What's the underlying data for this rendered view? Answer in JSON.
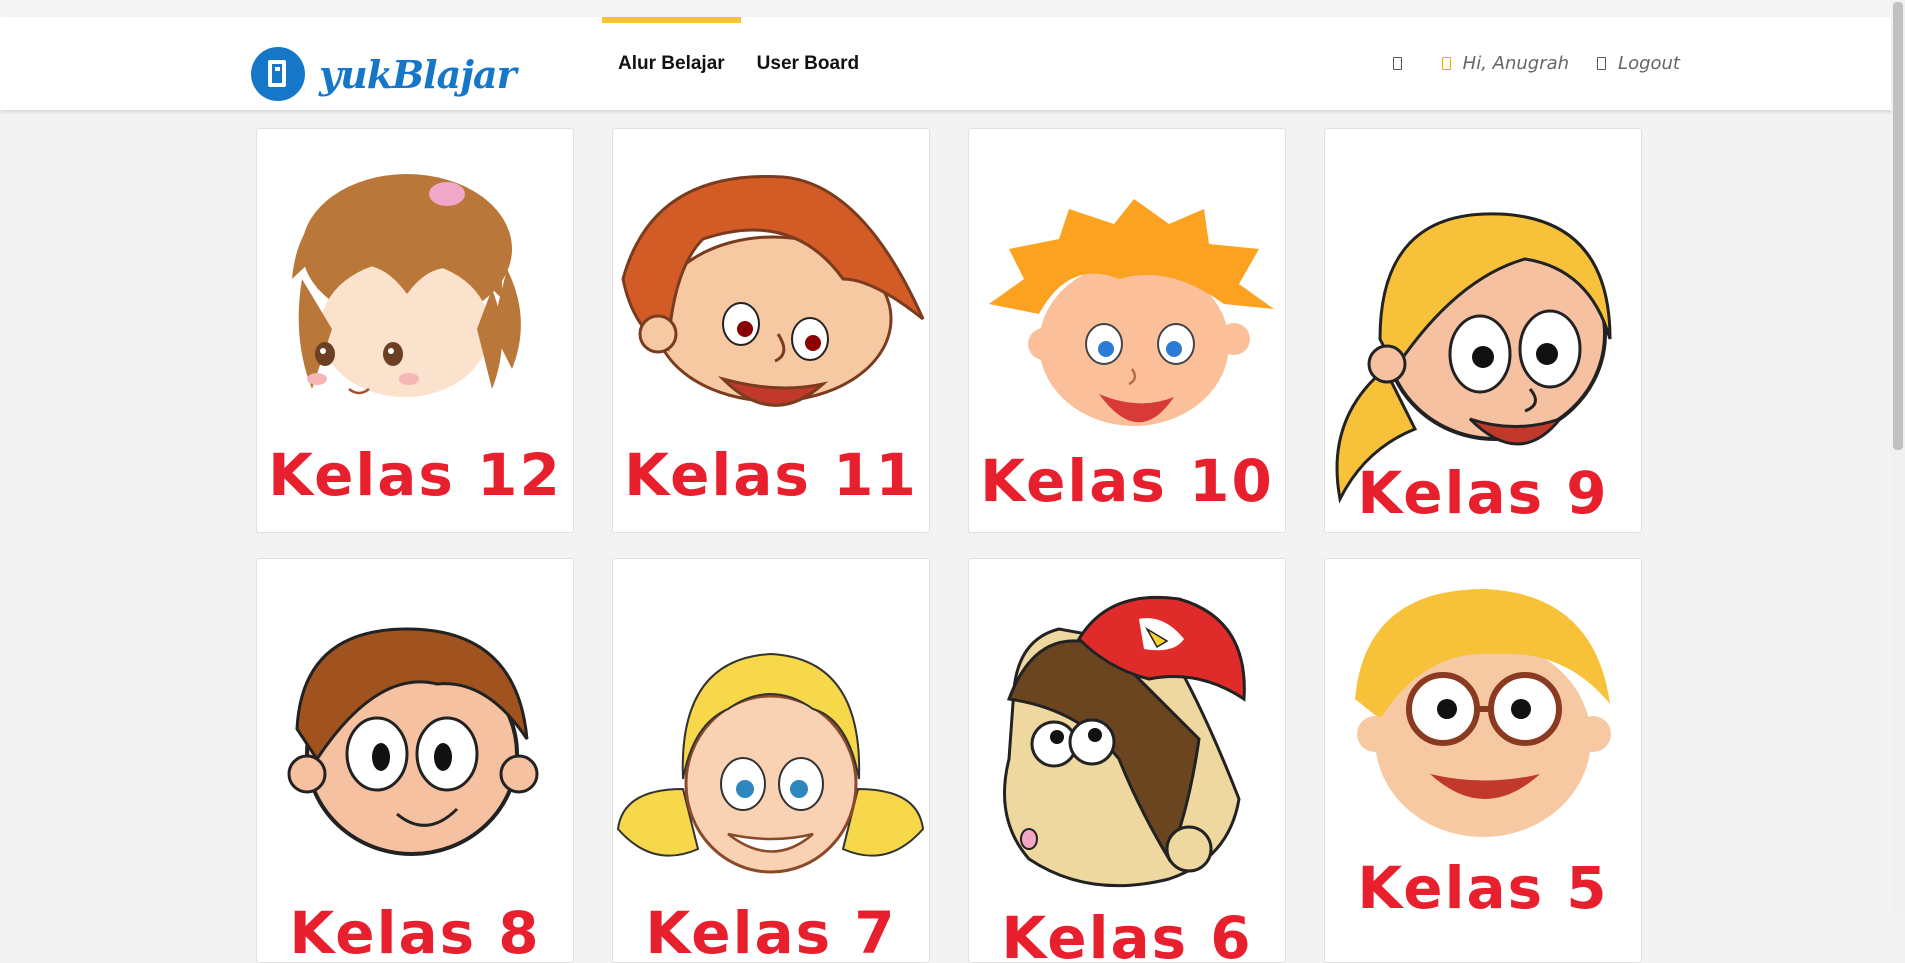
{
  "header": {
    "logo_text": "yukBlajar",
    "nav": [
      {
        "label": "Alur Belajar",
        "active": true
      },
      {
        "label": "User Board",
        "active": false
      }
    ],
    "user": {
      "greeting": "Hi, Anugrah",
      "logout_label": "Logout"
    }
  },
  "colors": {
    "brand_blue": "#1677c9",
    "accent_yellow": "#f8c238",
    "kelas_red": "#e8202e"
  },
  "grades": [
    {
      "label": "Kelas 12",
      "character": "girl-brown-hair"
    },
    {
      "label": "Kelas 11",
      "character": "boy-orange-hair"
    },
    {
      "label": "Kelas 10",
      "character": "boy-blonde-spiky"
    },
    {
      "label": "Kelas 9",
      "character": "girl-blonde-ponytail"
    },
    {
      "label": "Kelas 8",
      "character": "boy-brown-hair"
    },
    {
      "label": "Kelas 7",
      "character": "girl-blonde-pigtails"
    },
    {
      "label": "Kelas 6",
      "character": "boy-red-cap"
    },
    {
      "label": "Kelas 5",
      "character": "boy-glasses"
    }
  ]
}
